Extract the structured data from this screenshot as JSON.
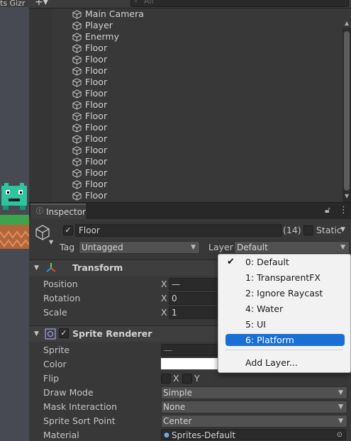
{
  "scene": {
    "tabs_text": "ts Gizr"
  },
  "hierarchy": {
    "search_placeholder": "All",
    "items": [
      "Main Camera",
      "Player",
      "Enermy",
      "Floor",
      "Floor",
      "Floor",
      "Floor",
      "Floor",
      "Floor",
      "Floor",
      "Floor",
      "Floor",
      "Floor",
      "Floor",
      "Floor",
      "Floor",
      "Floor"
    ]
  },
  "inspector": {
    "tab_label": "Inspector",
    "object_name": "Floor",
    "count": "(14)",
    "static_label": "Static",
    "tag_label": "Tag",
    "tag_value": "Untagged",
    "layer_label": "Layer",
    "layer_value": "Default",
    "transform": {
      "title": "Transform",
      "position_label": "Position",
      "rotation_label": "Rotation",
      "scale_label": "Scale",
      "x_label": "X",
      "position_x": "—",
      "rotation_x": "0",
      "scale_x": "1"
    },
    "sprite_renderer": {
      "title": "Sprite Renderer",
      "sprite_label": "Sprite",
      "sprite_value": "—",
      "color_label": "Color",
      "flip_label": "Flip",
      "flip_x": "X",
      "flip_y": "Y",
      "draw_mode_label": "Draw Mode",
      "draw_mode_value": "Simple",
      "mask_label": "Mask Interaction",
      "mask_value": "None",
      "sort_point_label": "Sprite Sort Point",
      "sort_point_value": "Center",
      "material_label": "Material",
      "material_value": "Sprites-Default"
    }
  },
  "layer_menu": {
    "items": [
      "0: Default",
      "1: TransparentFX",
      "2: Ignore Raycast",
      "4: Water",
      "5: UI",
      "6: Platform"
    ],
    "checked_index": 0,
    "highlighted_index": 5,
    "add_label": "Add Layer..."
  },
  "colors": {
    "highlight": "#1a6fd4",
    "character": "#2ec4a0",
    "grass": "#3fa34d",
    "dirt": "#b5653a"
  }
}
